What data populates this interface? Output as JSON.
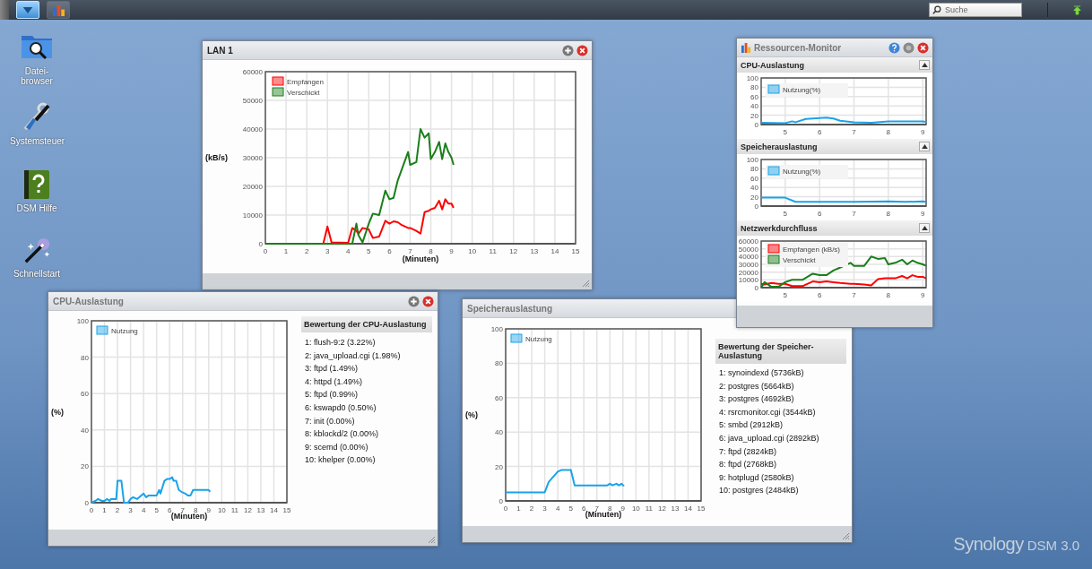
{
  "taskbar": {
    "buttons": [
      {
        "kind": "menu",
        "selected": true
      },
      {
        "kind": "monitor",
        "selected": false
      }
    ],
    "search": {
      "placeholder": "Suche"
    }
  },
  "desktop_icons": [
    {
      "kind": "folder",
      "label": "Datei-browser"
    },
    {
      "kind": "tools",
      "label": "Systemsteuer"
    },
    {
      "kind": "help",
      "label": "DSM Hilfe"
    },
    {
      "kind": "wand",
      "label": "Schnellstart"
    }
  ],
  "lan_window": {
    "title": "LAN 1",
    "chart_data": {
      "type": "line",
      "xlabel": "(Minuten)",
      "ylabel": "(kB/s)",
      "x": [
        0,
        1,
        2,
        2.8,
        3,
        3.2,
        4,
        4.2,
        4.4,
        4.5,
        4.7,
        5,
        5.2,
        5.5,
        5.8,
        6,
        6.2,
        6.4,
        6.6,
        6.9,
        7,
        7.3,
        7.5,
        7.7,
        7.9,
        8,
        8.2,
        8.4,
        8.55,
        8.7,
        8.85,
        9,
        9.1
      ],
      "grid": true,
      "legend": true,
      "xlim": [
        0,
        15
      ],
      "ylim": [
        0,
        60000
      ],
      "xticks": [
        0,
        1,
        2,
        3,
        4,
        5,
        6,
        7,
        8,
        9,
        10,
        11,
        12,
        13,
        14,
        15
      ],
      "yticks": [
        0,
        10000,
        20000,
        30000,
        40000,
        50000,
        60000
      ],
      "series": [
        {
          "name": "Empfangen",
          "color": "#ff0000",
          "values": [
            null,
            null,
            null,
            0,
            6000,
            500,
            300,
            5500,
            4500,
            3500,
            5500,
            5000,
            2000,
            2500,
            8000,
            7000,
            7800,
            7500,
            6500,
            5500,
            5500,
            4500,
            3500,
            11000,
            11500,
            12000,
            12500,
            15000,
            12000,
            15500,
            14000,
            14000,
            12500
          ]
        },
        {
          "name": "Verschickt",
          "color": "#1a7f1a",
          "values": [
            0,
            0,
            0,
            0,
            0,
            0,
            0,
            0,
            7000,
            3000,
            500,
            7000,
            10500,
            10000,
            18500,
            15500,
            16000,
            22000,
            26000,
            32000,
            27500,
            28500,
            40000,
            37000,
            38500,
            29500,
            32000,
            35500,
            29500,
            35000,
            32000,
            30000,
            27500
          ]
        }
      ]
    }
  },
  "resource_monitor": {
    "title": "Ressourcen-Monitor",
    "sections": [
      {
        "title": "CPU-Auslastung",
        "chart_data": {
          "type": "line",
          "x": [
            4.3,
            5,
            5.2,
            5.3,
            5.6,
            6,
            6.2,
            6.4,
            6.6,
            7,
            7.5,
            8,
            9,
            9.1
          ],
          "grid": true,
          "legend": true,
          "xlim": [
            4.3,
            9.1
          ],
          "ylim": [
            0,
            100
          ],
          "xticks": [
            5,
            6,
            7,
            8,
            9
          ],
          "yticks": [
            0,
            20,
            40,
            60,
            80,
            100
          ],
          "series": [
            {
              "name": "Nutzung(%)",
              "color": "#1aa3e8",
              "values": [
                4,
                3,
                7,
                5,
                12,
                14,
                15,
                13,
                8,
                5,
                4,
                7,
                7,
                6
              ]
            }
          ]
        }
      },
      {
        "title": "Speicherauslastung",
        "chart_data": {
          "type": "line",
          "x": [
            4.3,
            5,
            5.3,
            6,
            7,
            8,
            8.5,
            9,
            9.1
          ],
          "grid": true,
          "legend": true,
          "xlim": [
            4.3,
            9.1
          ],
          "ylim": [
            0,
            100
          ],
          "xticks": [
            5,
            6,
            7,
            8,
            9
          ],
          "yticks": [
            0,
            20,
            40,
            60,
            80,
            100
          ],
          "series": [
            {
              "name": "Nutzung(%)",
              "color": "#1aa3e8",
              "values": [
                18,
                18,
                9,
                9,
                9,
                10,
                9,
                10,
                9
              ]
            }
          ]
        }
      },
      {
        "title": "Netzwerkdurchfluss",
        "chart_data": {
          "type": "line",
          "x": [
            4.3,
            4.4,
            4.6,
            4.8,
            5,
            5.2,
            5.5,
            5.8,
            6,
            6.2,
            6.4,
            6.6,
            6.9,
            7,
            7.3,
            7.5,
            7.7,
            7.9,
            8,
            8.2,
            8.4,
            8.55,
            8.7,
            8.85,
            9,
            9.1
          ],
          "grid": true,
          "legend": true,
          "xlim": [
            4.3,
            9.1
          ],
          "ylim": [
            0,
            60000
          ],
          "xticks": [
            5,
            6,
            7,
            8,
            9
          ],
          "yticks": [
            0,
            10000,
            20000,
            30000,
            40000,
            50000,
            60000
          ],
          "series": [
            {
              "name": "Empfangen (kB/s)",
              "color": "#ff0000",
              "values": [
                5000,
                4000,
                6000,
                5000,
                5000,
                2000,
                2000,
                8000,
                7000,
                8000,
                7000,
                6000,
                5000,
                5000,
                4000,
                3000,
                11000,
                12000,
                12000,
                12000,
                15000,
                12000,
                16000,
                14000,
                14000,
                12000
              ]
            },
            {
              "name": "Verschickt",
              "color": "#1a7f1a",
              "values": [
                0,
                7000,
                1000,
                1000,
                7000,
                10000,
                10000,
                18000,
                16000,
                16000,
                22000,
                26000,
                32000,
                28000,
                28000,
                40000,
                37000,
                38000,
                30000,
                32000,
                36000,
                30000,
                35000,
                32000,
                30000,
                28000
              ]
            }
          ]
        }
      }
    ]
  },
  "cpu_window": {
    "title": "CPU-Auslastung",
    "chart_data": {
      "type": "line",
      "xlabel": "(Minuten)",
      "ylabel": "(%)",
      "x": [
        0,
        0.3,
        0.5,
        0.8,
        1,
        1.2,
        1.4,
        1.5,
        1.9,
        2,
        2.3,
        2.5,
        2.8,
        3,
        3.2,
        3.5,
        4,
        4.2,
        4.4,
        4.6,
        5,
        5.2,
        5.3,
        5.6,
        5.8,
        6,
        6.2,
        6.3,
        6.5,
        6.7,
        6.9,
        7.2,
        7.4,
        7.6,
        7.8,
        8.5,
        9,
        9.1
      ],
      "grid": true,
      "legend": true,
      "xlim": [
        0,
        15
      ],
      "ylim": [
        0,
        100
      ],
      "xticks": [
        0,
        1,
        2,
        3,
        4,
        5,
        6,
        7,
        8,
        9,
        10,
        11,
        12,
        13,
        14,
        15
      ],
      "yticks": [
        0,
        20,
        40,
        60,
        80,
        100
      ],
      "series": [
        {
          "name": "Nutzung",
          "color": "#1aa3e8",
          "values": [
            0,
            1,
            2,
            1,
            1,
            2,
            1,
            2,
            2,
            12,
            12,
            0,
            0,
            2,
            3,
            2,
            5,
            3,
            4,
            4,
            4,
            7,
            5,
            12,
            13,
            13,
            14,
            12,
            12,
            7,
            6,
            5,
            4,
            4,
            7,
            7,
            7,
            6
          ]
        }
      ]
    },
    "ranking": {
      "title": "Bewertung der CPU-Auslastung",
      "items": [
        "1: flush-9:2 (3.22%)",
        "2: java_upload.cgi (1.98%)",
        "3: ftpd (1.49%)",
        "4: httpd (1.49%)",
        "5: ftpd (0.99%)",
        "6: kswapd0 (0.50%)",
        "7: init (0.00%)",
        "8: kblockd/2 (0.00%)",
        "9: scemd (0.00%)",
        "10: khelper (0.00%)"
      ]
    }
  },
  "memory_window": {
    "title": "Speicherauslastung",
    "chart_data": {
      "type": "line",
      "xlabel": "(Minuten)",
      "ylabel": "(%)",
      "x": [
        0,
        3,
        3.3,
        4,
        4.3,
        5,
        5.3,
        7.8,
        8,
        8.2,
        8.5,
        8.7,
        8.9,
        9,
        9.1
      ],
      "grid": true,
      "legend": true,
      "xlim": [
        0,
        15
      ],
      "ylim": [
        0,
        100
      ],
      "xticks": [
        0,
        1,
        2,
        3,
        4,
        5,
        6,
        7,
        8,
        9,
        10,
        11,
        12,
        13,
        14,
        15
      ],
      "yticks": [
        0,
        20,
        40,
        60,
        80,
        100
      ],
      "series": [
        {
          "name": "Nutzung",
          "color": "#1aa3e8",
          "values": [
            5,
            5,
            11,
            17,
            18,
            18,
            9,
            9,
            10,
            9,
            10,
            9,
            10,
            9,
            9
          ]
        }
      ]
    },
    "ranking": {
      "title": "Bewertung der Speicher-Auslastung",
      "items": [
        "1: synoindexd (5736kB)",
        "2: postgres (5664kB)",
        "3: postgres (4692kB)",
        "4: rsrcmonitor.cgi (3544kB)",
        "5: smbd (2912kB)",
        "6: java_upload.cgi (2892kB)",
        "7: ftpd (2824kB)",
        "8: ftpd (2768kB)",
        "9: hotplugd (2580kB)",
        "10: postgres (2484kB)"
      ]
    }
  },
  "wallpaper_logo": {
    "brand": "Synology",
    "product": "DSM 3.0"
  }
}
